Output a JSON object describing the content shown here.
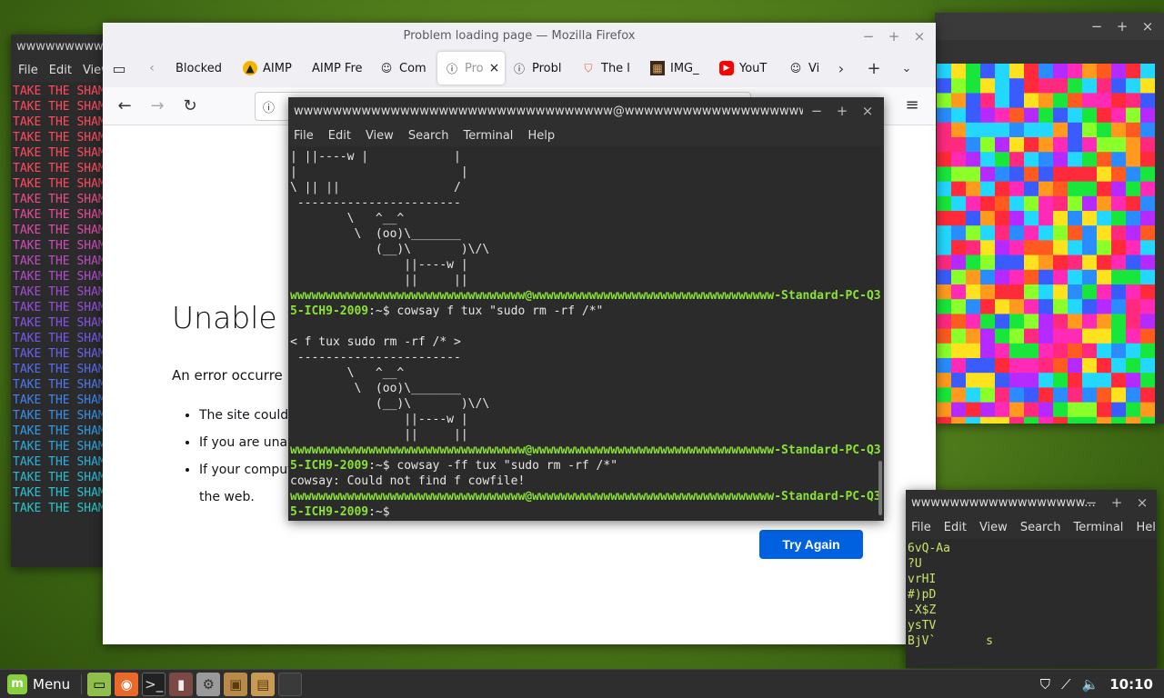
{
  "left_terminal": {
    "title": "wwwwwwwww",
    "menu": [
      "File",
      "Edit",
      "View"
    ],
    "shame_text": "TAKE THE SHAM",
    "shame_colors": [
      "#ff4a5c",
      "#ff4a5c",
      "#ff4a5c",
      "#ff4a5c",
      "#ff4a5c",
      "#ff4a5c",
      "#ff4a5c",
      "#ee4a8a",
      "#e94a9a",
      "#e04aaa",
      "#d04ab8",
      "#c24ac4",
      "#b34acd",
      "#a34ad6",
      "#944ee0",
      "#8552e8",
      "#7658ec",
      "#6662ee",
      "#586cef",
      "#4a78ef",
      "#3e84ef",
      "#3490ec",
      "#2e9ce8",
      "#2aa8e2",
      "#28b2dc",
      "#26bcd6",
      "#26c4d2",
      "#26c8cc"
    ]
  },
  "firefox": {
    "window_title": "Problem loading page — Mozilla Firefox",
    "tabs": [
      {
        "label": "Blocked",
        "icon": "none"
      },
      {
        "label": "AIMP",
        "icon": "aimp-icon"
      },
      {
        "label": "AIMP Fre",
        "icon": "none"
      },
      {
        "label": "Com",
        "icon": "community-icon"
      },
      {
        "label": "Pro",
        "icon": "info-icon",
        "active": true
      },
      {
        "label": "Probl",
        "icon": "info-icon"
      },
      {
        "label": "The l",
        "icon": "brave-icon"
      },
      {
        "label": "IMG_",
        "icon": "image-icon"
      },
      {
        "label": "YouT",
        "icon": "youtube-icon"
      },
      {
        "label": "Vi",
        "icon": "community-icon"
      }
    ],
    "error_title": "Unable to",
    "error_desc": "An error occurre",
    "error_items": [
      "The site could",
      "If you are unab",
      "If your comput"
    ],
    "error_item_cont": "the web.",
    "try_again": "Try Again"
  },
  "main_terminal": {
    "title": "wwwwwwwwwwwwwwwwwwwwwwwwwwwwwwwww@wwwwwwwwwwwwwwwwwww...",
    "menu": [
      "File",
      "Edit",
      "View",
      "Search",
      "Terminal",
      "Help"
    ],
    "out1": "| ||----w |            |\n|                       |\n\\ || ||                /\n -----------------------\n        \\   ^__^\n         \\  (oo)\\_______\n            (__)\\       )\\/\\\n                ||----w |\n                ||     ||",
    "prompt_user": "wwwwwwwwwwwwwwwwwwwwwwwwwwwwwwwww@wwwwwwwwwwwwwwwwwwwwwwwwwwwwwwwwww-Standard-PC-Q3",
    "prompt_host": "5-ICH9-2009",
    "prompt_tail": ":~$ ",
    "cmd1": "cowsay f tux \"sudo rm -rf /*\"",
    "out2": "\n< f tux sudo rm -rf /* >\n -----------------------\n        \\   ^__^\n         \\  (oo)\\_______\n            (__)\\       )\\/\\\n                ||----w |\n                ||     ||",
    "cmd2": "cowsay -ff tux \"sudo rm -rf /*\"",
    "err2": "cowsay: Could not find f cowfile!"
  },
  "small_terminal": {
    "title": "wwwwwwwwwwwwwwwwww...",
    "menu": [
      "File",
      "Edit",
      "View",
      "Search",
      "Terminal",
      "Help"
    ],
    "lines": "6vQ-Aa\n?U\nvrHI\n#)pD\n-X$Z\nysTV\nBjV`       s"
  },
  "panel": {
    "menu_label": "Menu",
    "clock": "10:10",
    "launchers": [
      "files-icon",
      "firefox-icon",
      "terminal-icon",
      "app-icon",
      "settings-icon",
      "package-icon",
      "archive-icon"
    ]
  },
  "grid_colors": [
    "#ff2a3a",
    "#19e63a",
    "#3a5cff",
    "#ff9a1f",
    "#ff2ab5",
    "#23d7ff",
    "#ffe21f",
    "#b42aff",
    "#8aff2a",
    "#ff5a1f",
    "#2a8cff",
    "#ff2a7d"
  ]
}
